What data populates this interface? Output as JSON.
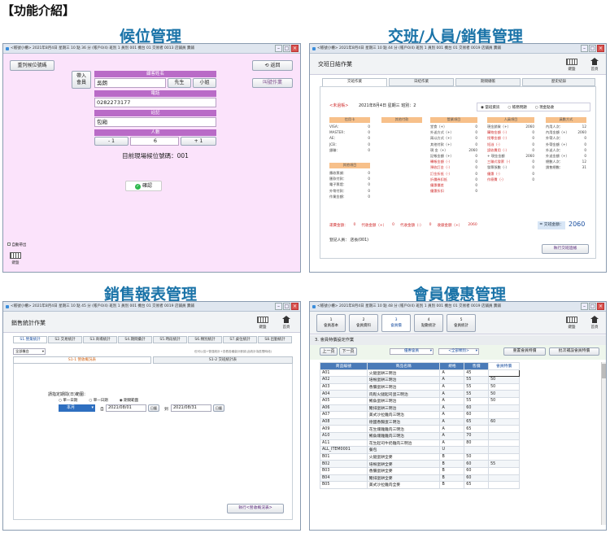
{
  "header": "【功能介紹】",
  "panels": {
    "p1": {
      "title": "候位管理"
    },
    "p2": {
      "title": "交班/人員/銷售管理"
    },
    "p3": {
      "title": "銷售報表管理"
    },
    "p4": {
      "title": "會員優惠管理"
    }
  },
  "w1": {
    "titlebar": "<帳號小櫃> 2021年8月4日 星期三 10 點 36 分 (帳戶0/4) 班別 1 員別 001 機台 01 交易者 0013 店鋪員 賣鋪",
    "reprint": "重列候位號碼",
    "back": "返回",
    "call": "叫號作業",
    "import": "帶入\n會員",
    "name_label": "顧客姓名",
    "name_value": "吳朗",
    "mr": "先生",
    "ms": "小姐",
    "phone_label": "電話",
    "phone_value": "0282273177",
    "note_label": "註記",
    "note_value": "包廂",
    "count_label": "人數",
    "minus": "- 1",
    "count_value": "6",
    "plus": "+ 1",
    "current": "目前現場候位號碼：001",
    "confirm": "確認",
    "auto_print": "自動帶出",
    "keyboard": "鍵盤"
  },
  "w2": {
    "titlebar": "<帳號小櫃> 2021年8月4日 星期三 10 點 44 分 (帳戶0/4) 班別 1 員別 001 機台 01 交易者 0019 店鋪員 賣鋪",
    "header": "交班日結作業",
    "keyboard": "鍵盤",
    "home": "首頁",
    "tabs": [
      "交班作業",
      "日結作業",
      "期間總帳",
      "歷史紀錄"
    ],
    "not_closed": "<未過帳>",
    "date_shift": "2021年8月4日  星期三   班別：2",
    "radios": [
      "當班資訊",
      "帳務問題",
      "現金點收"
    ],
    "col_heads": [
      "信用卡",
      "其他付款",
      "營業項目",
      "人員項目",
      "員數方式"
    ],
    "rows_a": [
      [
        "VISA：",
        "0"
      ],
      [
        "MASTER：",
        "0"
      ],
      [
        "AE：",
        "0"
      ],
      [
        "JCB：",
        "0"
      ],
      [
        "銀聯：",
        "0"
      ]
    ],
    "rows_b": [
      [
        "應收票據：",
        "0"
      ],
      [
        "匯款付款：",
        "0"
      ],
      [
        "電子票證：",
        "0"
      ],
      [
        "外幣付款：",
        "0"
      ],
      [
        "作業金額：",
        "0"
      ]
    ],
    "more_head": "其他項目",
    "rows_c": [
      [
        "堂食（+）",
        "0"
      ],
      [
        "外送方式（+）",
        "0"
      ],
      [
        "兩以方式（+）",
        "0"
      ],
      [
        "其他付款（+）",
        "0"
      ],
      [
        "現 金（+）",
        "2060"
      ],
      [
        "記帳金額（+）",
        "0"
      ],
      [
        "轉帳金額（-）",
        "0"
      ],
      [
        "預收訂金（-）",
        "0"
      ],
      [
        "訂金折抵（-）",
        "0"
      ],
      [
        "折價券扣抵",
        "0"
      ],
      [
        "優惠價差",
        "0"
      ],
      [
        "優惠折扣",
        "0"
      ]
    ],
    "rows_d": [
      [
        "現金銷貨（+）",
        "2060"
      ],
      [
        "購物金額（-）",
        "0"
      ],
      [
        "找零金額（-）",
        "0"
      ],
      [
        "短溢（-）",
        "0"
      ],
      [
        "誤收費用（-）",
        "0"
      ],
      [
        "+ 現金金額",
        "2060"
      ],
      [
        "三聯式發票（-）",
        "0"
      ],
      [
        "發票張數（-）",
        "0"
      ],
      [
        "優惠（-）",
        "0"
      ],
      [
        "作廢費（-）",
        "0"
      ]
    ],
    "rows_e": [
      [
        "內用人次：",
        "12"
      ],
      [
        "內用金額（+）",
        "2060"
      ],
      [
        "外帶人次：",
        "0"
      ],
      [
        "外帶金額（+）",
        "0"
      ],
      [
        "外送人次：",
        "0"
      ],
      [
        "外送金額（+）",
        "0"
      ],
      [
        "總數人次：",
        "12"
      ],
      [
        "銷售總數：",
        "31"
      ]
    ],
    "footer": [
      "運費金額：",
      "0",
      "代收金額（+）",
      "0",
      "代收金額（-）",
      "0",
      "收銀金額（+）",
      "2060"
    ],
    "cash_total_label": "= 交班金額：",
    "cash_total": "2060",
    "registrant": "登記人員：",
    "registrant_val": "店長(001)",
    "execute": "執行交班過帳"
  },
  "w3": {
    "titlebar": "<帳號小櫃> 2021年8月4日 星期三 10 點 45 分 (帳戶0/4) 班別 1 員別 001 機台 01 交易者 0019 店鋪員 賣鋪",
    "header": "銷售統計作業",
    "keyboard": "鍵盤",
    "home": "首頁",
    "tabs": [
      "S1.營業統計",
      "S2.交易統計",
      "S3.商場統計",
      "S4.期間彙計",
      "S5.時段統計",
      "S6.類別統計",
      "S7.桌位統計",
      "S8.出勤統計"
    ],
    "select_all": "全部機台",
    "note": "但可以從+營運統計+查看各種彙計數據(此統計為區間時段)",
    "subtabs": [
      "S1-1 營收概況表",
      "S1-2 交班統計表"
    ],
    "date_label": "請指定期間(日)範圍：",
    "radios": [
      "單一日期",
      "單一日期",
      "期間範圍"
    ],
    "month": "本月",
    "from_label": "自",
    "from_date": "2021/08/01",
    "cal": "日曆",
    "to_label": "到",
    "to_date": "2021/08/31",
    "execute": "執行<營收概況表>"
  },
  "w4": {
    "titlebar": "<帳號小櫃> 2021年8月4日 星期三 10 點 48 分 (帳戶0/4) 班別 1 員別 001 機台 01 交易者 0019 店鋪員 賣鋪",
    "tools": [
      [
        "1",
        "會員基本"
      ],
      [
        "2",
        "會員資料"
      ],
      [
        "3",
        "會員價"
      ],
      [
        "4",
        "點數統計"
      ],
      [
        "5",
        "會員統計"
      ]
    ],
    "keyboard": "鍵盤",
    "home": "首頁",
    "section": "3. 會員特價設定作業",
    "prev": "上一頁",
    "next": "下一頁",
    "member_select": "優惠會員",
    "type_select": "<全部類別>",
    "reset_btn": "重置會員特價",
    "batch_btn": "批次補設會員特價",
    "columns": [
      "商品編號",
      "商品名稱",
      "規格",
      "售價",
      "會員特價"
    ],
    "rows": [
      [
        "A01",
        "火腿蛋餅三明治",
        "A",
        "45",
        ""
      ],
      [
        "A02",
        "培根蛋餅三明治",
        "A",
        "55",
        "50"
      ],
      [
        "A03",
        "香腸蛋餅三明治",
        "A",
        "55",
        "50"
      ],
      [
        "A04",
        "肉鬆火腿起司蛋三明治",
        "A",
        "55",
        "50"
      ],
      [
        "A05",
        "鮪魚蛋餅三明治",
        "A",
        "55",
        "50"
      ],
      [
        "A06",
        "豬排蛋餅三明治",
        "A",
        "60",
        ""
      ],
      [
        "A07",
        "美式沙拉雞肉三明治",
        "A",
        "60",
        ""
      ],
      [
        "A08",
        "德國香腸蛋三明治",
        "A",
        "65",
        "60"
      ],
      [
        "A09",
        "花生燻雞雞肉三明治",
        "A",
        "65",
        ""
      ],
      [
        "A10",
        "鮪魚燻雞雞肉三明治",
        "A",
        "70",
        ""
      ],
      [
        "A11",
        "花生起司牛奶雞肉三明治",
        "A",
        "80",
        ""
      ],
      [
        "ALL_ITEM0001",
        "餐包",
        "U",
        "",
        ""
      ],
      [
        "B01",
        "火腿蛋餅全麥",
        "B",
        "50",
        ""
      ],
      [
        "B02",
        "培根蛋餅全麥",
        "B",
        "60",
        "55"
      ],
      [
        "B03",
        "香腸蛋餅全麥",
        "B",
        "60",
        ""
      ],
      [
        "B04",
        "豬排蛋餅全麥",
        "B",
        "60",
        ""
      ],
      [
        "B05",
        "美式沙拉雞肉全麥",
        "B",
        "65",
        ""
      ]
    ]
  }
}
